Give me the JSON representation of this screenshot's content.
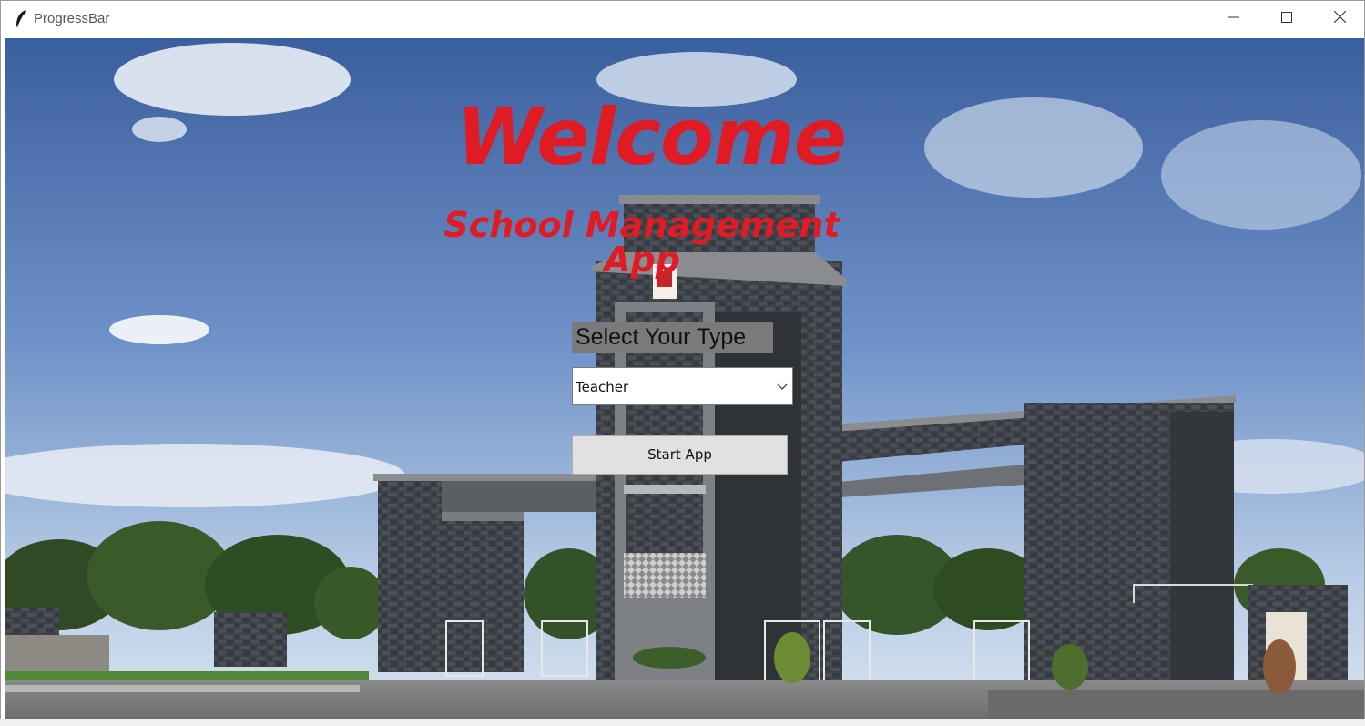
{
  "window": {
    "title": "ProgressBar",
    "icon": "feather-icon",
    "controls": [
      "minimize-icon",
      "maximize-icon",
      "close-icon"
    ]
  },
  "main": {
    "welcome_text": "Welcome",
    "subtitle_text": "School Management App",
    "select_label": "Select Your Type",
    "type_combobox": {
      "selected_value": "Teacher"
    },
    "start_button_label": "Start App"
  },
  "colors": {
    "heading_red": "#e01b24",
    "label_bg": "#7a7a7a",
    "button_bg": "#e1e1e1"
  }
}
